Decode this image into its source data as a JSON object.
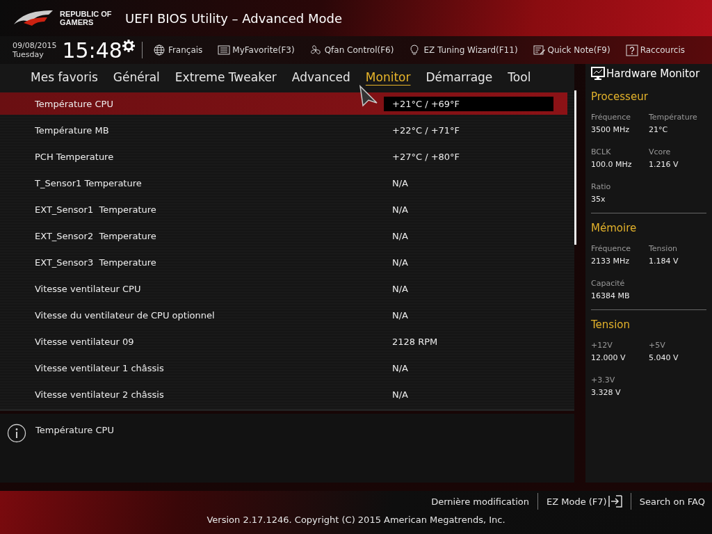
{
  "header": {
    "logo_text": "REPUBLIC OF GAMERS",
    "title": "UEFI BIOS Utility – Advanced Mode"
  },
  "toolbar": {
    "date": "09/08/2015",
    "day": "Tuesday",
    "time": "15:48",
    "items": [
      {
        "kind": "language",
        "label": "Français"
      },
      {
        "kind": "favorite",
        "label": "MyFavorite(F3)"
      },
      {
        "kind": "fan",
        "label": "Qfan Control(F6)"
      },
      {
        "kind": "wizard",
        "label": "EZ Tuning Wizard(F11)"
      },
      {
        "kind": "note",
        "label": "Quick Note(F9)"
      },
      {
        "kind": "help",
        "label": "Raccourcis"
      }
    ]
  },
  "tabs": [
    {
      "label": "Mes favoris",
      "selected": false
    },
    {
      "label": "Général",
      "selected": false
    },
    {
      "label": "Extreme Tweaker",
      "selected": false
    },
    {
      "label": "Advanced",
      "selected": false
    },
    {
      "label": "Monitor",
      "selected": true
    },
    {
      "label": "Démarrage",
      "selected": false
    },
    {
      "label": "Tool",
      "selected": false
    }
  ],
  "settings": [
    {
      "label": "Température CPU",
      "value": "+21°C / +69°F",
      "selected": true
    },
    {
      "label": "Température MB",
      "value": "+22°C / +71°F",
      "selected": false
    },
    {
      "label": "PCH Temperature",
      "value": "+27°C / +80°F",
      "selected": false
    },
    {
      "label": "T_Sensor1 Temperature",
      "value": "N/A",
      "selected": false
    },
    {
      "label": "EXT_Sensor1  Temperature",
      "value": "N/A",
      "selected": false
    },
    {
      "label": "EXT_Sensor2  Temperature",
      "value": "N/A",
      "selected": false
    },
    {
      "label": "EXT_Sensor3  Temperature",
      "value": "N/A",
      "selected": false
    },
    {
      "label": "Vitesse ventilateur CPU",
      "value": "N/A",
      "selected": false
    },
    {
      "label": "Vitesse du ventilateur de CPU optionnel",
      "value": "N/A",
      "selected": false
    },
    {
      "label": "Vitesse ventilateur 09",
      "value": "2128 RPM",
      "selected": false
    },
    {
      "label": "Vitesse ventilateur 1 châssis",
      "value": "N/A",
      "selected": false
    },
    {
      "label": "Vitesse ventilateur 2 châssis",
      "value": "N/A",
      "selected": false
    }
  ],
  "help": {
    "text": "Température CPU"
  },
  "hardware_monitor": {
    "title": "Hardware Monitor",
    "sections": [
      {
        "title": "Processeur",
        "readings": [
          {
            "label": "Fréquence",
            "value": "3500 MHz"
          },
          {
            "label": "Température",
            "value": "21°C"
          },
          {
            "label": "BCLK",
            "value": "100.0 MHz"
          },
          {
            "label": "Vcore",
            "value": "1.216 V"
          },
          {
            "label": "Ratio",
            "value": "35x"
          }
        ]
      },
      {
        "title": "Mémoire",
        "readings": [
          {
            "label": "Fréquence",
            "value": "2133 MHz"
          },
          {
            "label": "Tension",
            "value": "1.184 V"
          },
          {
            "label": "Capacité",
            "value": "16384 MB"
          }
        ]
      },
      {
        "title": "Tension",
        "readings": [
          {
            "label": "+12V",
            "value": "12.000 V"
          },
          {
            "label": "+5V",
            "value": "5.040 V"
          },
          {
            "label": "+3.3V",
            "value": "3.328 V"
          }
        ]
      }
    ]
  },
  "footer": {
    "links": [
      {
        "kind": "plain",
        "label": "Dernière modification"
      },
      {
        "kind": "exit",
        "label": "EZ Mode (F7)"
      },
      {
        "kind": "plain",
        "label": "Search on FAQ"
      }
    ],
    "version": "Version 2.17.1246. Copyright (C) 2015 American Megatrends, Inc."
  }
}
